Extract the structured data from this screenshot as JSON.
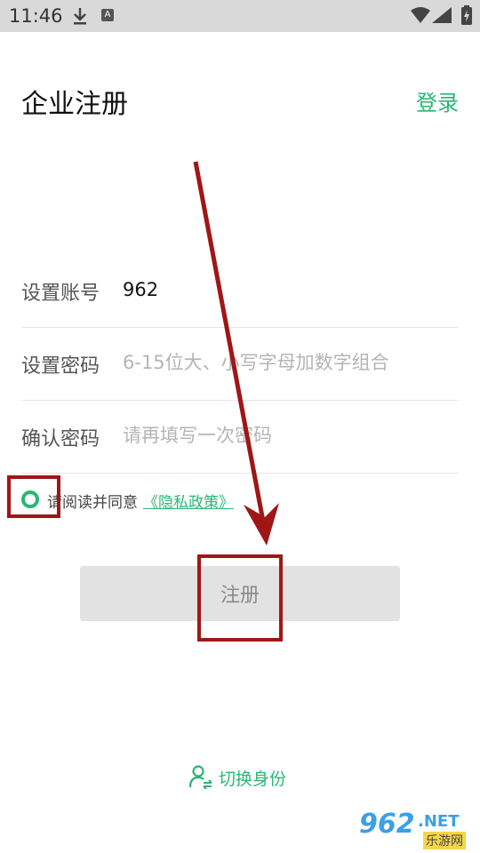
{
  "status_bar": {
    "time": "11:46",
    "download_icon": "download-icon",
    "notification_badge": "A",
    "wifi_icon": "wifi-icon",
    "signal_icon": "signal-icon",
    "battery_icon": "battery-charging-icon"
  },
  "header": {
    "title": "企业注册",
    "login_label": "登录"
  },
  "form": {
    "account": {
      "label": "设置账号",
      "value": "962",
      "placeholder": ""
    },
    "password": {
      "label": "设置密码",
      "value": "",
      "placeholder": "6-15位大、小写字母加数字组合"
    },
    "confirm": {
      "label": "确认密码",
      "value": "",
      "placeholder": "请再填写一次密码"
    }
  },
  "agreement": {
    "text": "请阅读并同意",
    "link": "《隐私政策》",
    "checked": false
  },
  "register_button": {
    "label": "注册",
    "enabled": false
  },
  "switch_role": {
    "label": "切换身份",
    "icon": "user-switch-icon"
  },
  "watermark": {
    "number": "962",
    "suffix": ".NET",
    "site": "乐游网"
  },
  "colors": {
    "accent": "#2bb673",
    "annotation": "#a01616",
    "button_disabled_bg": "#e2e2e2",
    "button_disabled_text": "#8a8a8a"
  }
}
